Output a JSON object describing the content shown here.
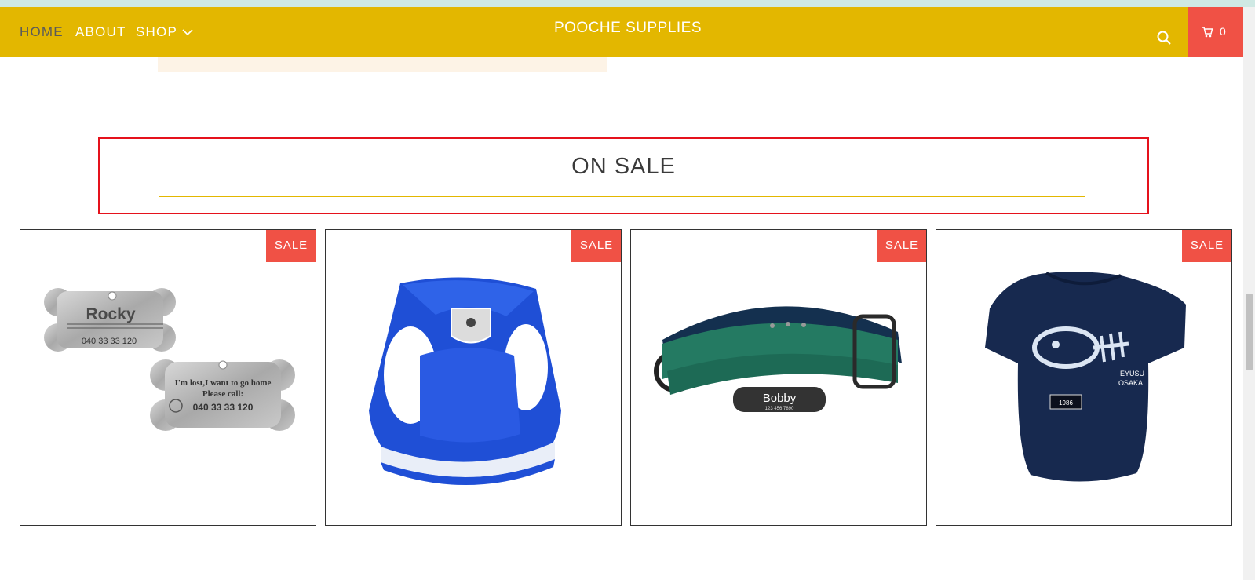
{
  "nav": {
    "home": "HOME",
    "about": "ABOUT",
    "shop": "SHOP",
    "brand": "POOCHE SUPPLIES",
    "cart_count": "0"
  },
  "section": {
    "title": "ON SALE"
  },
  "products": [
    {
      "badge": "SALE",
      "image": "pet-id-tags",
      "tag1_name": "Rocky",
      "tag1_phone": "040 33 33 120",
      "tag2_line1": "I'm lost,I want to go home",
      "tag2_line2": "Please call:",
      "tag2_phone": "040 33 33 120"
    },
    {
      "badge": "SALE",
      "image": "blue-mesh-harness"
    },
    {
      "badge": "SALE",
      "image": "green-leather-collar",
      "collar_name": "Bobby",
      "collar_phone": "123 456 7890"
    },
    {
      "badge": "SALE",
      "image": "navy-dog-shirt",
      "shirt_text1": "EYUSU",
      "shirt_text2": "OSAKA",
      "shirt_label": "1986"
    }
  ],
  "colors": {
    "nav_bg": "#e3b700",
    "accent_red": "#f05145",
    "outline_red": "#e5121c"
  }
}
